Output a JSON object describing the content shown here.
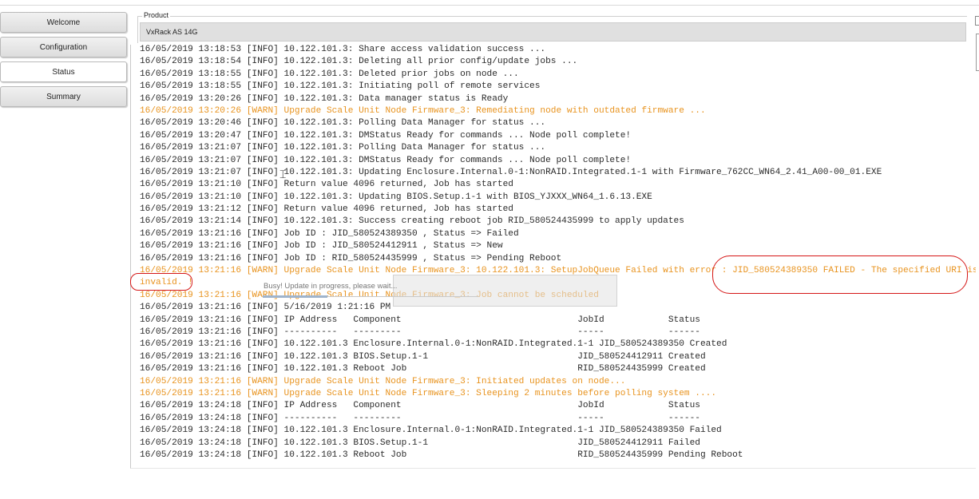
{
  "nav": {
    "welcome": "Welcome",
    "configuration": "Configuration",
    "status": "Status",
    "summary": "Summary"
  },
  "product": {
    "legend": "Product",
    "value": "VxRack AS 14G"
  },
  "busy": {
    "text": "Busy! Update in progress, please wait...",
    "progress_fraction": 0.3
  },
  "colors": {
    "warn": "#e8931e",
    "info": "#2b2b2b",
    "annotation": "#d51717"
  },
  "log_lines": [
    {
      "text": "16/05/2019 13:18:53 [INFO] 10.122.101.3: Share access validation success ...",
      "level": "info"
    },
    {
      "text": "16/05/2019 13:18:54 [INFO] 10.122.101.3: Deleting all prior config/update jobs ...",
      "level": "info"
    },
    {
      "text": "16/05/2019 13:18:55 [INFO] 10.122.101.3: Deleted prior jobs on node ...",
      "level": "info"
    },
    {
      "text": "16/05/2019 13:18:55 [INFO] 10.122.101.3: Initiating poll of remote services",
      "level": "info"
    },
    {
      "text": "16/05/2019 13:20:26 [INFO] 10.122.101.3: Data manager status is Ready",
      "level": "info"
    },
    {
      "text": "16/05/2019 13:20:26 [WARN] Upgrade Scale Unit Node Firmware_3: Remediating node with outdated firmware ...",
      "level": "warn"
    },
    {
      "text": "16/05/2019 13:20:46 [INFO] 10.122.101.3: Polling Data Manager for status ...",
      "level": "info"
    },
    {
      "text": "16/05/2019 13:20:47 [INFO] 10.122.101.3: DMStatus Ready for commands ... Node poll complete!",
      "level": "info"
    },
    {
      "text": "16/05/2019 13:21:07 [INFO] 10.122.101.3: Polling Data Manager for status ...",
      "level": "info"
    },
    {
      "text": "16/05/2019 13:21:07 [INFO] 10.122.101.3: DMStatus Ready for commands ... Node poll complete!",
      "level": "info"
    },
    {
      "text": "16/05/2019 13:21:07 [INFO] 10.122.101.3: Updating Enclosure.Internal.0-1:NonRAID.Integrated.1-1 with Firmware_762CC_WN64_2.41_A00-00_01.EXE",
      "level": "info"
    },
    {
      "text": "16/05/2019 13:21:10 [INFO] Return value 4096 returned, Job has started",
      "level": "info"
    },
    {
      "text": "16/05/2019 13:21:10 [INFO] 10.122.101.3: Updating BIOS.Setup.1-1 with BIOS_YJXXX_WN64_1.6.13.EXE",
      "level": "info"
    },
    {
      "text": "16/05/2019 13:21:12 [INFO] Return value 4096 returned, Job has started",
      "level": "info"
    },
    {
      "text": "16/05/2019 13:21:14 [INFO] 10.122.101.3: Success creating reboot job RID_580524435999 to apply updates",
      "level": "info"
    },
    {
      "text": "16/05/2019 13:21:16 [INFO] Job ID : JID_580524389350 , Status => Failed",
      "level": "info"
    },
    {
      "text": "16/05/2019 13:21:16 [INFO] Job ID : JID_580524412911 , Status => New",
      "level": "info"
    },
    {
      "text": "16/05/2019 13:21:16 [INFO] Job ID : RID_580524435999 , Status => Pending Reboot",
      "level": "info"
    },
    {
      "text": "16/05/2019 13:21:16 [WARN] Upgrade Scale Unit Node Firmware_3: 10.122.101.3: SetupJobQueue Failed with error : JID_580524389350 FAILED - The specified URI is",
      "level": "warn"
    },
    {
      "text": "invalid. !",
      "level": "warn"
    },
    {
      "text": "16/05/2019 13:21:16 [WARN] Upgrade Scale Unit Node Firmware_3: Job cannot be scheduled",
      "level": "warn"
    },
    {
      "text": "16/05/2019 13:21:16 [INFO] 5/16/2019 1:21:16 PM",
      "level": "info"
    },
    {
      "text": "16/05/2019 13:21:16 [INFO] IP Address   Component                                 JobId            Status",
      "level": "info"
    },
    {
      "text": "16/05/2019 13:21:16 [INFO] ----------   ---------                                 -----            ------",
      "level": "info"
    },
    {
      "text": "16/05/2019 13:21:16 [INFO] 10.122.101.3 Enclosure.Internal.0-1:NonRAID.Integrated.1-1 JID_580524389350 Created",
      "level": "info"
    },
    {
      "text": "16/05/2019 13:21:16 [INFO] 10.122.101.3 BIOS.Setup.1-1                            JID_580524412911 Created",
      "level": "info"
    },
    {
      "text": "16/05/2019 13:21:16 [INFO] 10.122.101.3 Reboot Job                                RID_580524435999 Created",
      "level": "info"
    },
    {
      "text": "16/05/2019 13:21:16 [WARN] Upgrade Scale Unit Node Firmware_3: Initiated updates on node...",
      "level": "warn"
    },
    {
      "text": "16/05/2019 13:21:16 [WARN] Upgrade Scale Unit Node Firmware_3: Sleeping 2 minutes before polling system ....",
      "level": "warn"
    },
    {
      "text": "16/05/2019 13:24:18 [INFO] IP Address   Component                                 JobId            Status",
      "level": "info"
    },
    {
      "text": "16/05/2019 13:24:18 [INFO] ----------   ---------                                 -----            ------",
      "level": "info"
    },
    {
      "text": "16/05/2019 13:24:18 [INFO] 10.122.101.3 Enclosure.Internal.0-1:NonRAID.Integrated.1-1 JID_580524389350 Failed",
      "level": "info"
    },
    {
      "text": "16/05/2019 13:24:18 [INFO] 10.122.101.3 BIOS.Setup.1-1                            JID_580524412911 Failed",
      "level": "info"
    },
    {
      "text": "16/05/2019 13:24:18 [INFO] 10.122.101.3 Reboot Job                                RID_580524435999 Pending Reboot",
      "level": "info"
    }
  ]
}
